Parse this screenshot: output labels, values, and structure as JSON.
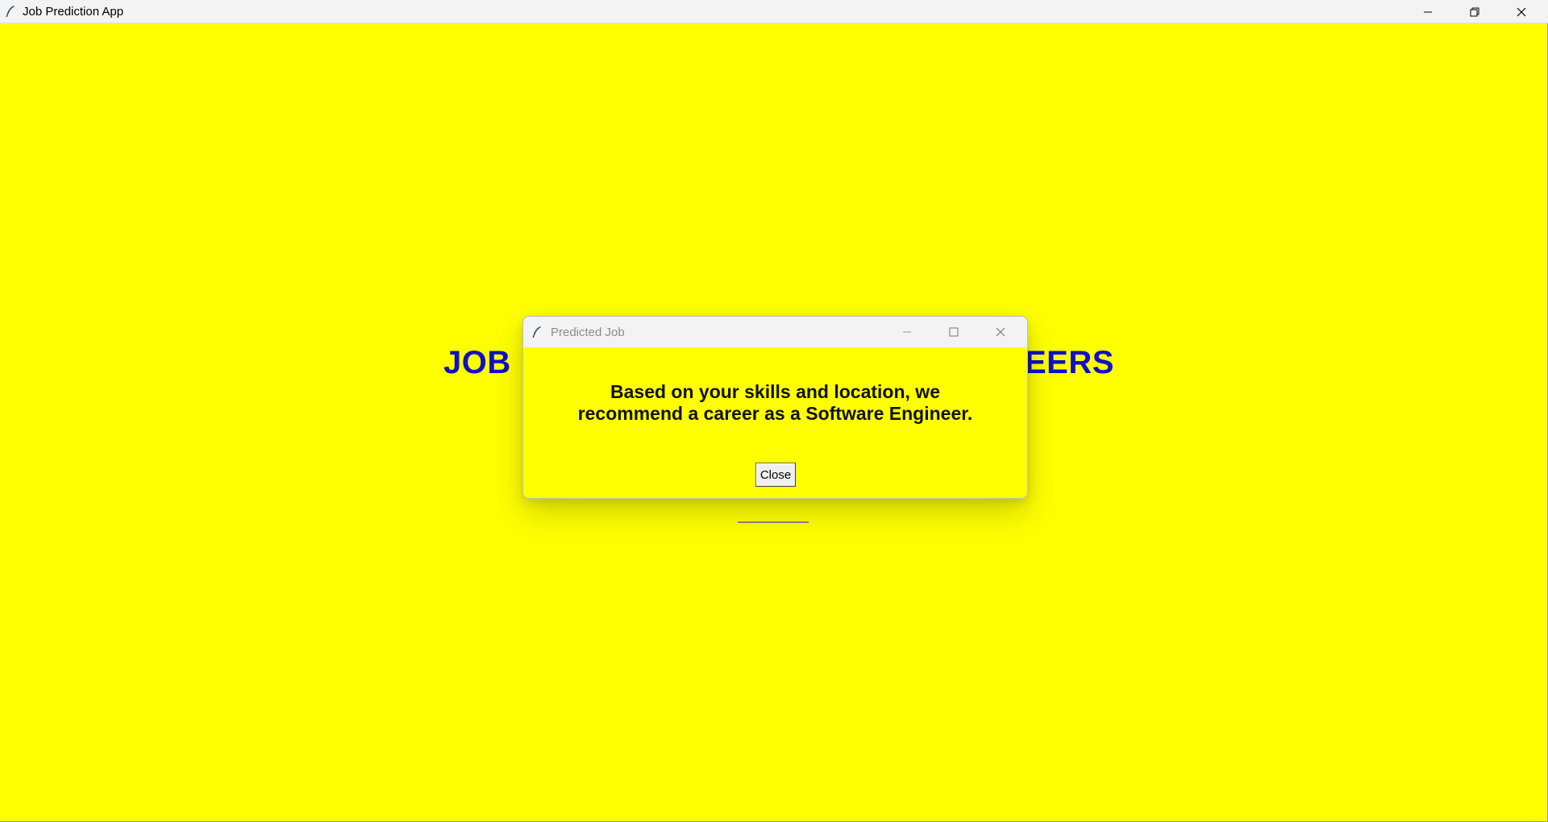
{
  "window": {
    "title": "Job Prediction App",
    "icon": "feather-icon",
    "controls": [
      "minimize-icon",
      "restore-icon",
      "close-icon"
    ]
  },
  "main": {
    "heading_left": "JOB I",
    "heading_right": "EERS",
    "background_color": "#ffff00",
    "heading_color": "#1010c8"
  },
  "dialog": {
    "title": "Predicted Job",
    "icon": "feather-icon",
    "controls": [
      "minimize-icon",
      "maximize-icon",
      "close-icon"
    ],
    "message_line1": "Based on your skills and location, we",
    "message_line2": "recommend a career as a Software Engineer.",
    "close_label": "Close"
  }
}
